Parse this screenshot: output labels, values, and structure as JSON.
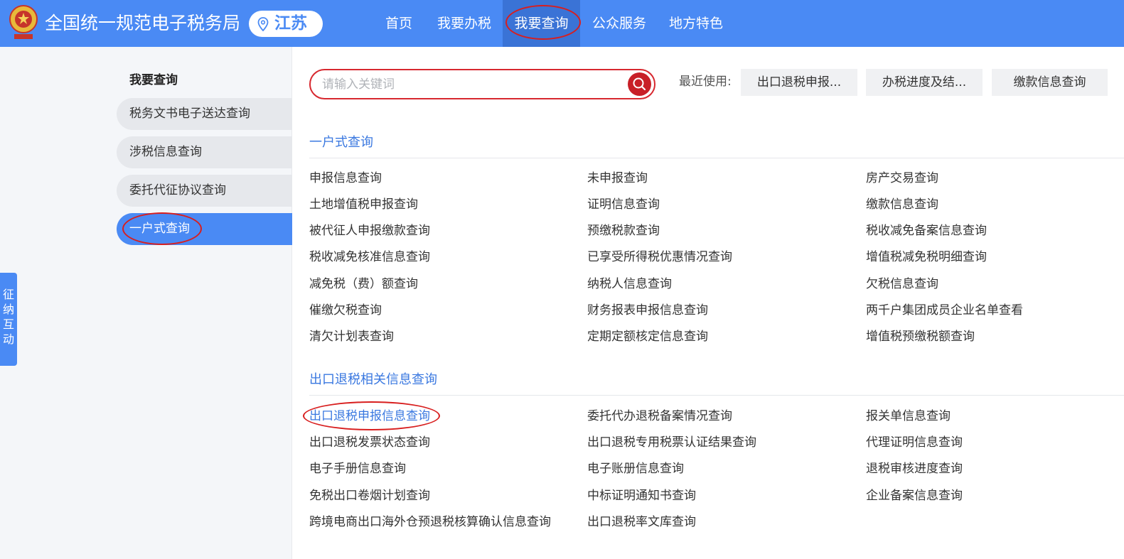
{
  "header": {
    "site_title": "全国统一规范电子税务局",
    "region": "江苏",
    "nav": [
      "首页",
      "我要办税",
      "我要查询",
      "公众服务",
      "地方特色"
    ],
    "active_nav_index": 2
  },
  "sidebar": {
    "title": "我要查询",
    "items": [
      "税务文书电子送达查询",
      "涉税信息查询",
      "委托代征协议查询",
      "一户式查询"
    ],
    "active_index": 3
  },
  "side_float": [
    "征",
    "纳",
    "互",
    "动"
  ],
  "search": {
    "placeholder": "请输入关键词",
    "recent_label": "最近使用:",
    "recent": [
      "出口退税申报...",
      "办税进度及结...",
      "缴款信息查询"
    ]
  },
  "sections": [
    {
      "title": "一户式查询",
      "links": [
        "申报信息查询",
        "未申报查询",
        "房产交易查询",
        "土地增值税申报查询",
        "证明信息查询",
        "缴款信息查询",
        "被代征人申报缴款查询",
        "预缴税款查询",
        "税收减免备案信息查询",
        "税收减免核准信息查询",
        "已享受所得税优惠情况查询",
        "增值税减免税明细查询",
        "减免税（费）额查询",
        "纳税人信息查询",
        "欠税信息查询",
        "催缴欠税查询",
        "财务报表申报信息查询",
        "两千户集团成员企业名单查看",
        "清欠计划表查询",
        "定期定额核定信息查询",
        "增值税预缴税额查询"
      ]
    },
    {
      "title": "出口退税相关信息查询",
      "links": [
        "出口退税申报信息查询",
        "委托代办退税备案情况查询",
        "报关单信息查询",
        "出口退税发票状态查询",
        "出口退税专用税票认证结果查询",
        "代理证明信息查询",
        "电子手册信息查询",
        "电子账册信息查询",
        "退税审核进度查询",
        "免税出口卷烟计划查询",
        "中标证明通知书查询",
        "企业备案信息查询",
        "跨境电商出口海外仓预退税核算确认信息查询",
        "出口退税率文库查询"
      ],
      "highlighted_index": 0
    }
  ],
  "colors": {
    "header_blue": "#4a8af4",
    "active_nav": "#3a73d6",
    "link_blue": "#3a78e0",
    "annotation_red": "#d81e1e",
    "search_red": "#c81f27"
  }
}
